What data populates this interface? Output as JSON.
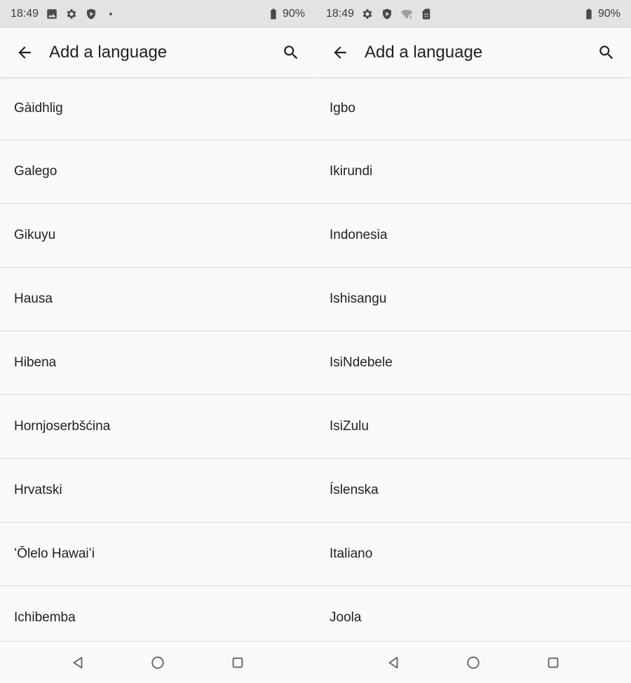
{
  "left": {
    "status": {
      "time": "18:49",
      "battery": "90%",
      "icons": [
        "image-icon",
        "settings-icon",
        "shield-icon",
        "dot-icon"
      ]
    },
    "toolbar": {
      "title": "Add a language"
    },
    "languages": [
      "Gàidhlig",
      "Galego",
      "Gikuyu",
      "Hausa",
      "Hibena",
      "Hornjoserbšćina",
      "Hrvatski",
      "ʻŌlelo Hawaiʻi",
      "Ichibemba"
    ]
  },
  "right": {
    "status": {
      "time": "18:49",
      "battery": "90%",
      "icons": [
        "settings-icon",
        "shield-icon",
        "wifi-unknown-icon",
        "sim-icon"
      ]
    },
    "toolbar": {
      "title": "Add a language"
    },
    "languages": [
      "Igbo",
      "Ikirundi",
      "Indonesia",
      "Ishisangu",
      "IsiNdebele",
      "IsiZulu",
      "Íslenska",
      "Italiano",
      "Joola"
    ]
  },
  "colors": {
    "statusbar": "#e3e3e3",
    "background": "#fafafa",
    "divider": "#d9d9d9",
    "text": "#202124"
  }
}
